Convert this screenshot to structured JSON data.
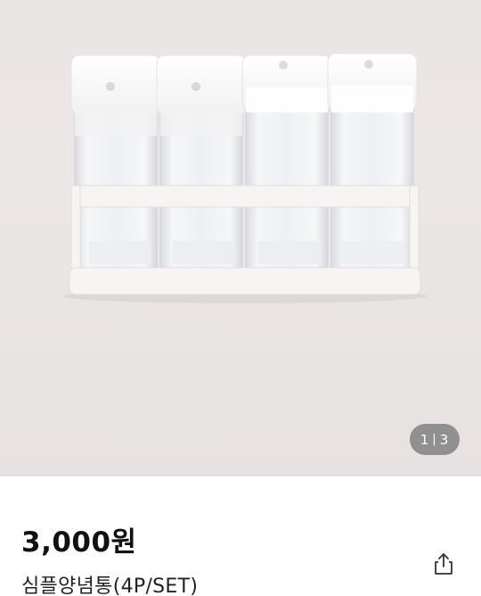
{
  "gallery": {
    "image_label": "product-photo",
    "counter": {
      "current": "1",
      "separator": "|",
      "total": "3"
    }
  },
  "product": {
    "price": "3,000원",
    "name": "심플양념통(4P/SET)"
  },
  "actions": {
    "share_icon": "share-icon"
  }
}
